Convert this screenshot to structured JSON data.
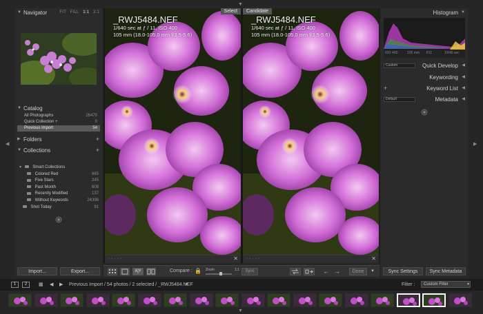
{
  "left": {
    "navigator": {
      "title": "Navigator",
      "zoom_options": [
        "FIT",
        "FILL",
        "1:1",
        "3:1"
      ],
      "active_zoom": "1:1"
    },
    "catalog": {
      "title": "Catalog",
      "items": [
        {
          "label": "All Photographs",
          "count": "26470"
        },
        {
          "label": "Quick Collection +",
          "count": "0"
        },
        {
          "label": "Previous Import",
          "count": "54"
        }
      ]
    },
    "folders": {
      "title": "Folders"
    },
    "collections": {
      "title": "Collections",
      "smart_label": "Smart Collections",
      "items": [
        {
          "label": "Colored Red",
          "count": "665"
        },
        {
          "label": "Five Stars",
          "count": "245"
        },
        {
          "label": "Past Month",
          "count": "608"
        },
        {
          "label": "Recently Modified",
          "count": "137"
        },
        {
          "label": "Without Keywords",
          "count": "24396"
        }
      ],
      "extra": {
        "label": "Shot Today",
        "count": "91"
      }
    },
    "import_label": "Import...",
    "export_label": "Export..."
  },
  "center": {
    "select_label": "Select",
    "candidate_label": "Candidate",
    "photo": {
      "filename": "_RWJ5484.NEF",
      "exposure": "1/640 sec at ƒ / 11, ISO 400",
      "lens": "105 mm (18.0-105.0 mm f/3.5-5.6)"
    }
  },
  "toolbar": {
    "xy_label": "X|Y",
    "compare_label": "Compare :",
    "zoom_label": "Zoom",
    "zoom_value": "1:1",
    "sync_label": "Sync",
    "done_label": "Done"
  },
  "right": {
    "histogram": {
      "title": "Histogram",
      "iso": "ISO 400",
      "focal": "105 mm",
      "aperture": "f/11",
      "shutter": "1/640 sec"
    },
    "quick_develop": {
      "title": "Quick Develop",
      "preset": "Custom"
    },
    "keywording": {
      "title": "Keywording"
    },
    "keyword_list": {
      "title": "Keyword List"
    },
    "metadata": {
      "title": "Metadata",
      "preset": "Default"
    },
    "sync_settings_label": "Sync Settings",
    "sync_metadata_label": "Sync Metadata"
  },
  "filmstrip_bar": {
    "box1": "1",
    "box2": "2",
    "path": "Previous Import / 54 photos / 2 selected / _RWJ5484.NEF",
    "filter_label": "Filter :",
    "filter_value": "Custom Filter"
  },
  "filmstrip": {
    "thumb_count": 18,
    "selected": [
      15,
      16
    ]
  },
  "colors": {
    "background": "#262626",
    "panel": "#2b2b2b",
    "selected_row": "#5a5a5a",
    "flower": "#c14fc8"
  }
}
